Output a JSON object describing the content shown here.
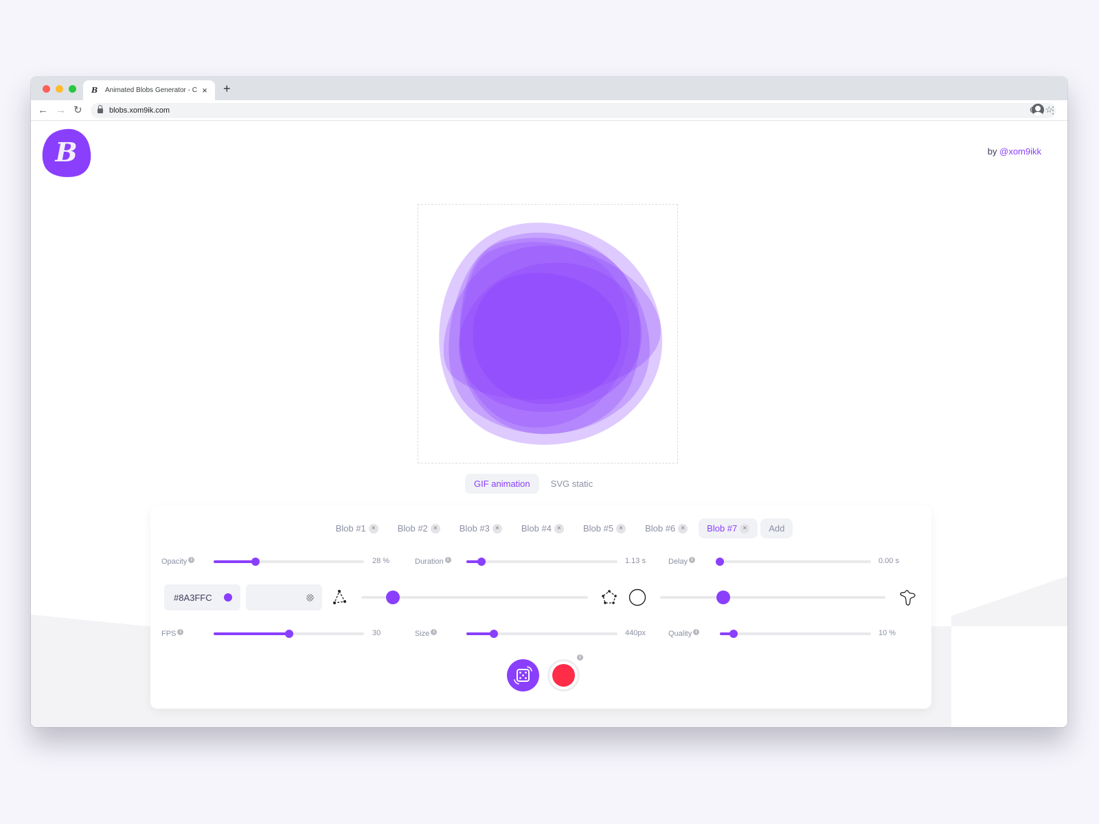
{
  "browser": {
    "tab_title": "Animated Blobs Generator - Cr",
    "tab_favicon": "B",
    "new_tab_label": "+",
    "url": "blobs.xom9ik.com",
    "icons": [
      "back-arrow-icon",
      "forward-arrow-icon",
      "reload-icon",
      "lock-icon",
      "install-app-icon",
      "bookmark-star-icon",
      "profile-avatar-icon",
      "more-menu-icon"
    ]
  },
  "header": {
    "logo_letter": "B",
    "byline_prefix": "by ",
    "byline_link": "@xom9ikk"
  },
  "mode_tabs": [
    {
      "label": "GIF animation",
      "active": true
    },
    {
      "label": "SVG static",
      "active": false
    }
  ],
  "blob_tabs": [
    {
      "label": "Blob #1",
      "active": false
    },
    {
      "label": "Blob #2",
      "active": false
    },
    {
      "label": "Blob #3",
      "active": false
    },
    {
      "label": "Blob #4",
      "active": false
    },
    {
      "label": "Blob #5",
      "active": false
    },
    {
      "label": "Blob #6",
      "active": false
    },
    {
      "label": "Blob #7",
      "active": true
    }
  ],
  "add_tab_label": "Add",
  "close_glyph": "×",
  "info_glyph": "i",
  "controls": {
    "opacity": {
      "label": "Opacity",
      "value": "28 %",
      "fraction": 0.28
    },
    "duration": {
      "label": "Duration",
      "value": "1.13 s",
      "fraction": 0.1
    },
    "delay": {
      "label": "Delay",
      "value": "0.00 s",
      "fraction": 0.0
    },
    "fps": {
      "label": "FPS",
      "value": "30",
      "fraction": 0.5
    },
    "size": {
      "label": "Size",
      "value": "440px",
      "fraction": 0.18
    },
    "quality": {
      "label": "Quality",
      "value": "10 %",
      "fraction": 0.09
    }
  },
  "color": {
    "hex": "#8A3FFC",
    "accent": "#8a3ffc",
    "second_color_placeholder": ""
  },
  "complexity_slider": {
    "fraction": 0.14,
    "left_icon": "triangle-points-icon",
    "right_icon": "pentagon-points-icon"
  },
  "contrast_slider": {
    "fraction": 0.28,
    "left_icon": "circle-icon",
    "right_icon": "irregular-blob-icon"
  },
  "actions": {
    "randomize_icon": "dice-icon",
    "record_icon": "record-icon",
    "record_color": "#ff2d48"
  }
}
